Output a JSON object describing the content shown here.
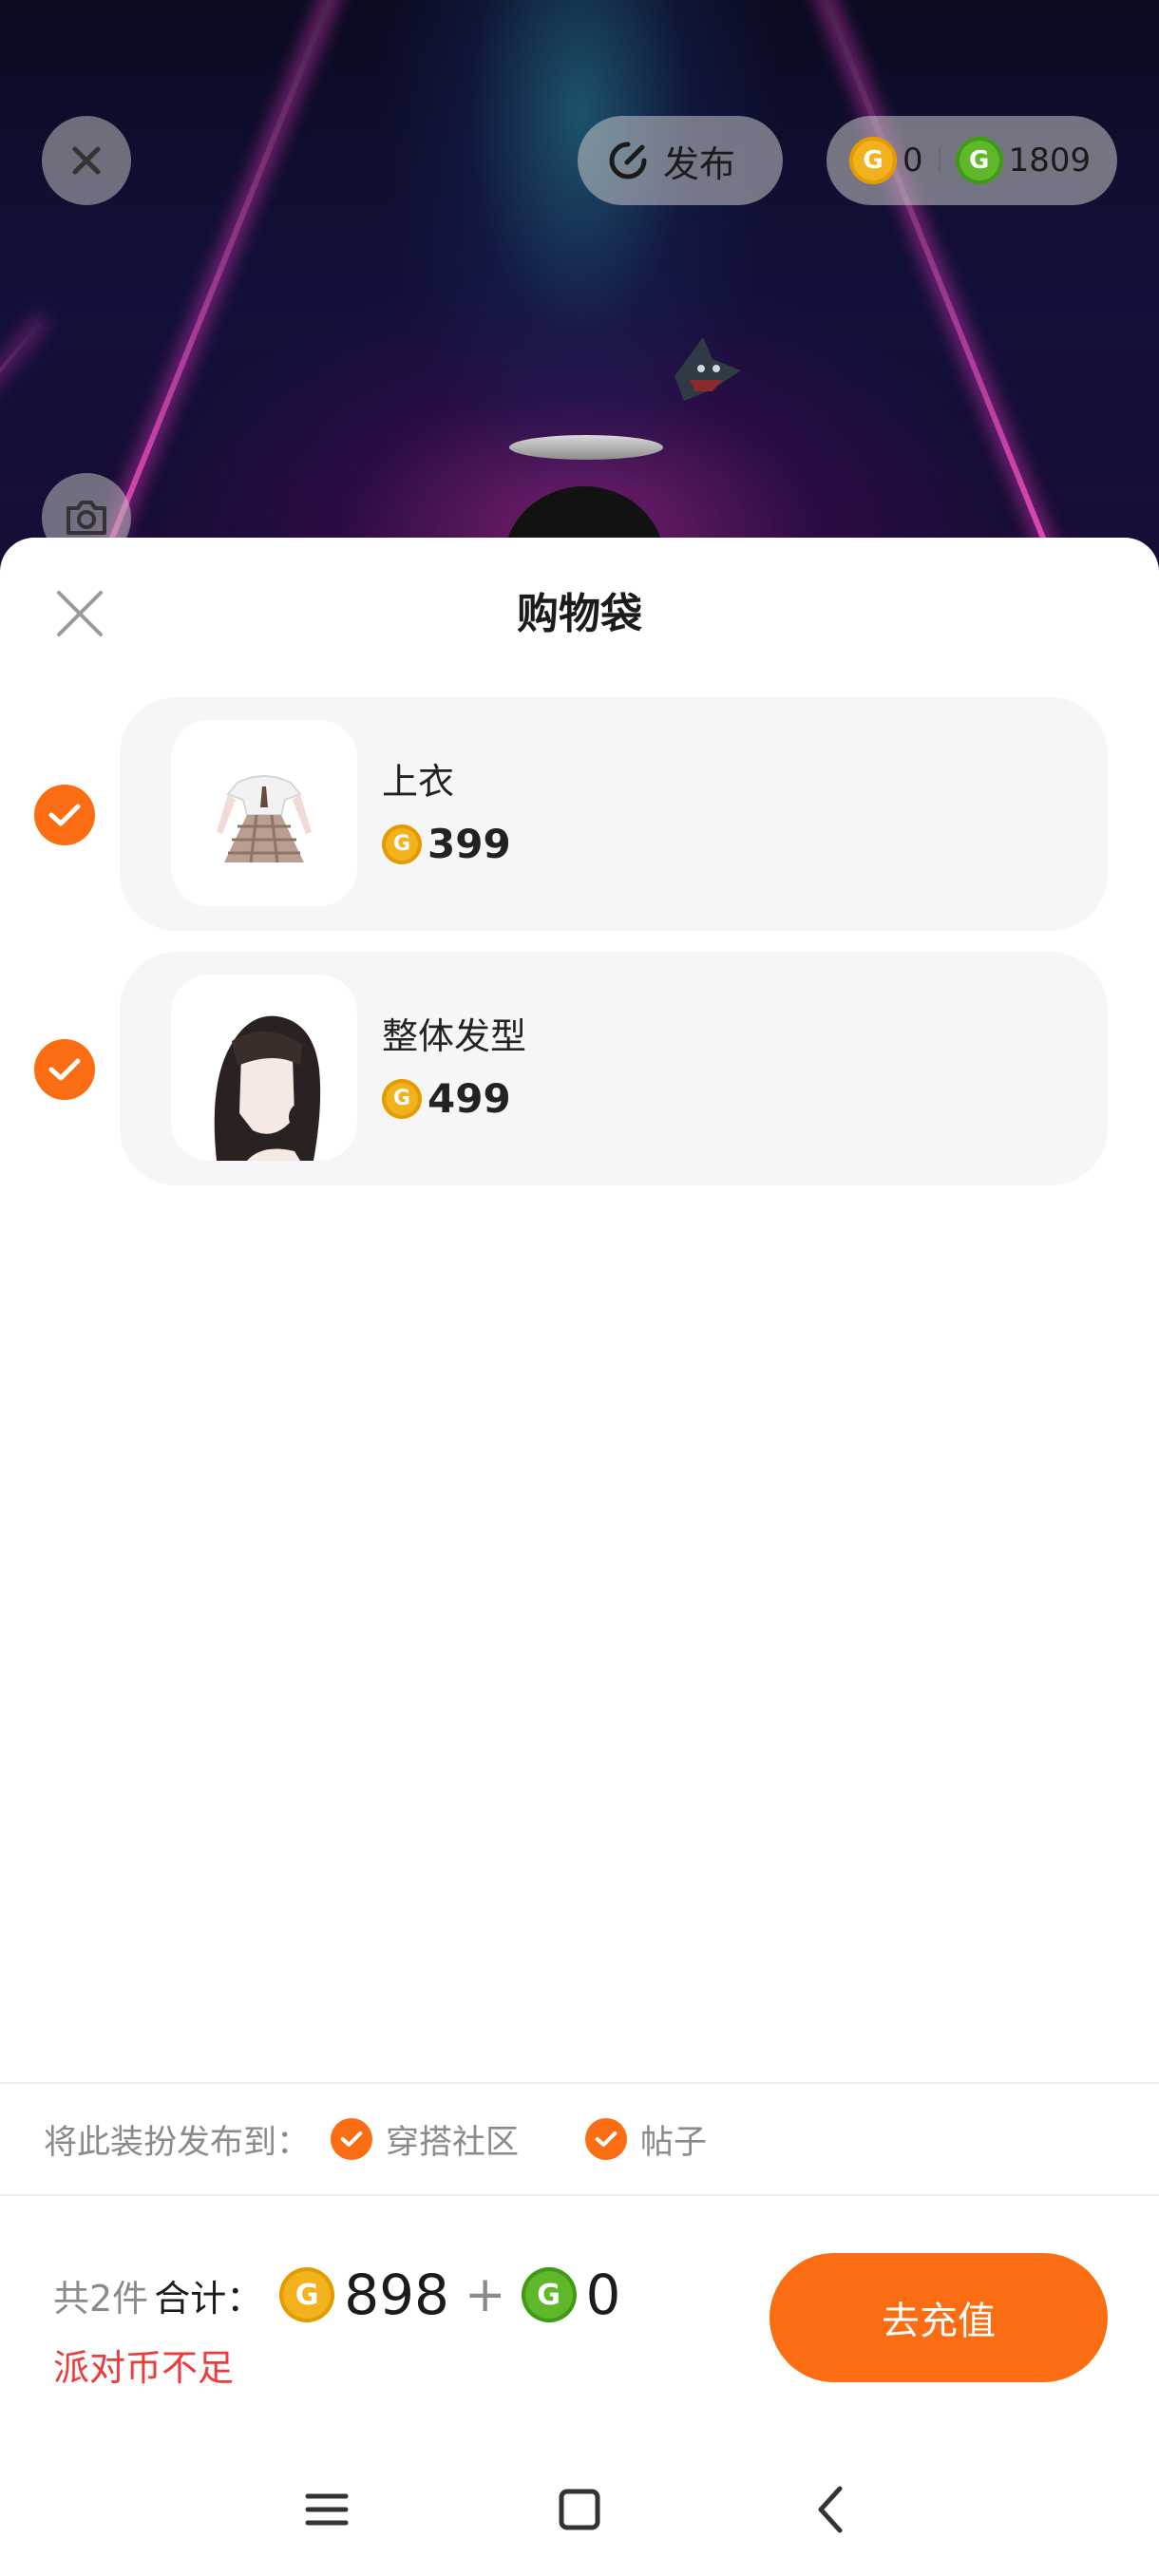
{
  "top_bar": {
    "publish_label": "发布",
    "gold_coins": "0",
    "green_coins": "1809"
  },
  "sheet": {
    "title": "购物袋",
    "items": [
      {
        "name": "上衣",
        "price": "399",
        "selected": true,
        "thumbnail": "dress-top-thumbnail"
      },
      {
        "name": "整体发型",
        "price": "499",
        "selected": true,
        "thumbnail": "hairstyle-thumbnail"
      }
    ],
    "publish_to": {
      "prefix": "将此装扮发布到：",
      "options": [
        {
          "label": "穿搭社区",
          "checked": true
        },
        {
          "label": "帖子",
          "checked": true
        }
      ]
    },
    "footer": {
      "count": "共2件",
      "total_label": "合计：",
      "gold_total": "898",
      "plus": "+",
      "green_total": "0",
      "warning": "派对币不足",
      "recharge_label": "去充值"
    }
  },
  "icons": {
    "coin_glyph": "G"
  },
  "colors": {
    "accent": "#fb6d12",
    "warning": "#ee3a3a",
    "gold_coin": "#f2b21d",
    "green_coin": "#5fb82a"
  }
}
